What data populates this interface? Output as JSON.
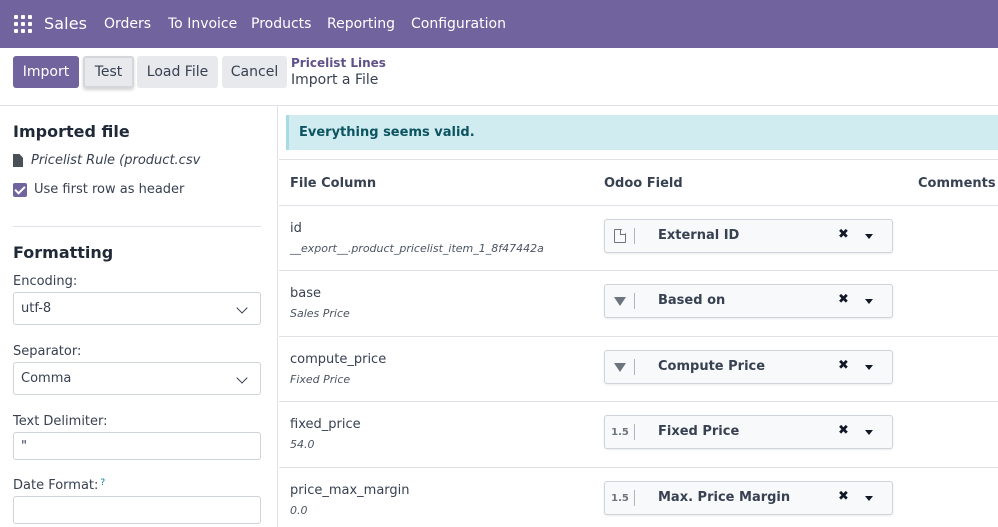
{
  "navbar": {
    "brand": "Sales",
    "menu": [
      "Orders",
      "To Invoice",
      "Products",
      "Reporting",
      "Configuration"
    ]
  },
  "control_panel": {
    "import_label": "Import",
    "test_label": "Test",
    "load_file_label": "Load File",
    "cancel_label": "Cancel",
    "breadcrumb_parent": "Pricelist Lines",
    "breadcrumb_current": "Import a File"
  },
  "sidebar": {
    "imported_file_title": "Imported file",
    "file_name": "Pricelist Rule (product.csv",
    "use_header_label": "Use first row as header",
    "use_header_checked": true,
    "formatting_title": "Formatting",
    "encoding_label": "Encoding:",
    "encoding_value": "utf-8",
    "separator_label": "Separator:",
    "separator_value": "Comma",
    "text_delimiter_label": "Text Delimiter:",
    "text_delimiter_value": "\"",
    "date_format_label": "Date Format:",
    "date_format_help": "?",
    "date_format_value": ""
  },
  "main": {
    "alert": "Everything seems valid.",
    "headers": {
      "file_column": "File Column",
      "odoo_field": "Odoo Field",
      "comments": "Comments"
    },
    "rows": [
      {
        "column": "id",
        "sample": "__export__.product_pricelist_item_1_8f47442a",
        "field": "External ID",
        "type_icon": "document-icon",
        "type_text": ""
      },
      {
        "column": "base",
        "sample": "Sales Price",
        "field": "Based on",
        "type_icon": "selection-triangle-icon",
        "type_text": ""
      },
      {
        "column": "compute_price",
        "sample": "Fixed Price",
        "field": "Compute Price",
        "type_icon": "selection-triangle-icon",
        "type_text": ""
      },
      {
        "column": "fixed_price",
        "sample": "54.0",
        "field": "Fixed Price",
        "type_icon": "float-icon",
        "type_text": "1.5"
      },
      {
        "column": "price_max_margin",
        "sample": "0.0",
        "field": "Max. Price Margin",
        "type_icon": "float-icon",
        "type_text": "1.5"
      }
    ]
  },
  "colors": {
    "primary": "#71639e",
    "alert_bg": "#d1ecf1",
    "alert_text": "#0c5460"
  }
}
